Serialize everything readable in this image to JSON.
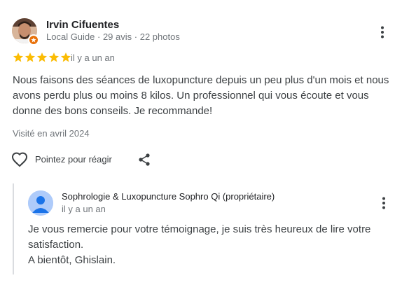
{
  "review": {
    "author_name": "Irvin Cifuentes",
    "author_level": "Local Guide",
    "author_reviews": "29 avis",
    "author_photos": "22 photos",
    "separator": " · ",
    "rating": 5,
    "rating_max": 5,
    "time": "il y a un an",
    "text": "Nous faisons des séances de luxopuncture depuis un peu plus d'un mois et nous avons perdu plus ou moins 8 kilos. Un professionnel qui vous écoute et vous donne des bons conseils. Je recommande!",
    "visited": "Visité en avril 2024",
    "like_label": "Pointez pour réagir"
  },
  "reply": {
    "owner_name": "Sophrologie & Luxopuncture Sophro Qi (propriétaire)",
    "time": "il y a un an",
    "lines": [
      "Je vous remercie pour votre témoignage, je suis très heureux de lire votre",
      "satisfaction.",
      "A bientôt, Ghislain."
    ]
  },
  "icons": {
    "kebab": "more-vert-icon",
    "heart": "heart-outline-icon",
    "share": "share-icon",
    "star": "star-icon",
    "badge": "local-guide-badge-icon"
  },
  "colors": {
    "star": "#fbbc04",
    "meta": "#70757a",
    "badge": "#e8710a",
    "owner_avatar": "#aecbfa"
  }
}
